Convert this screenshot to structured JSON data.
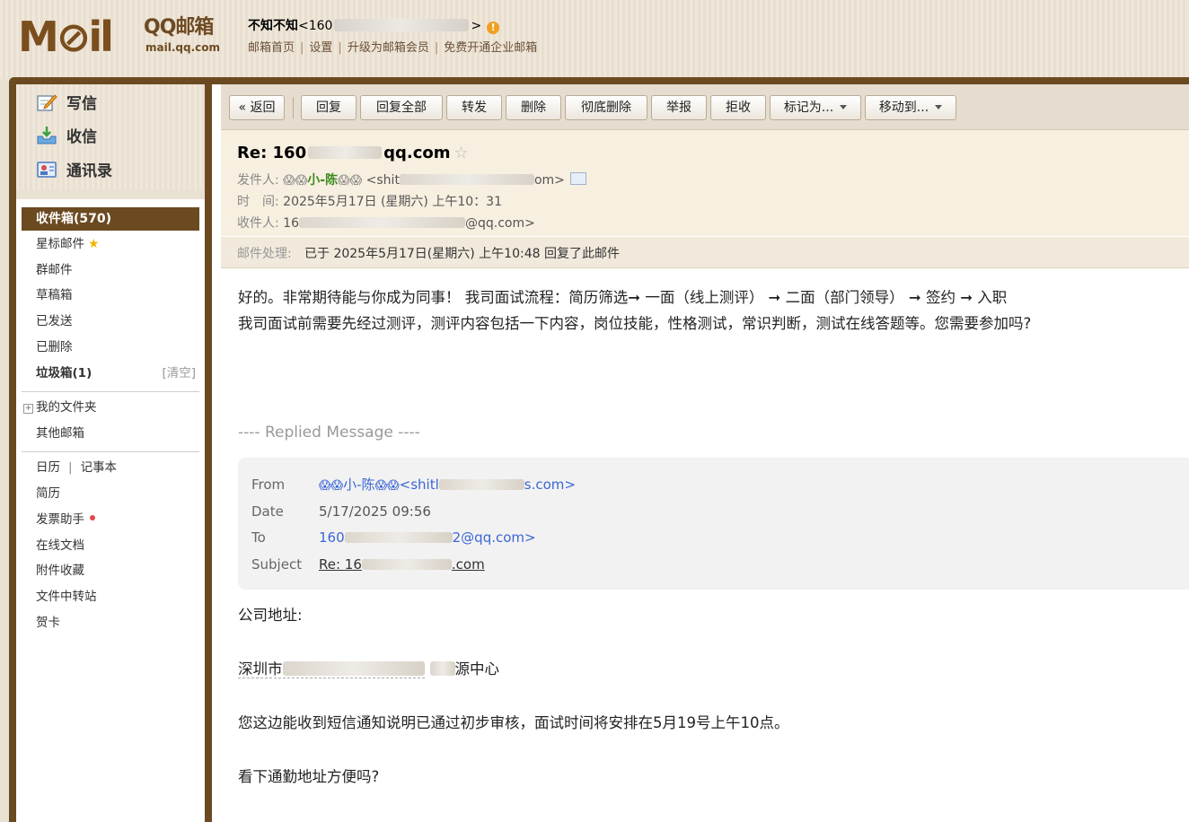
{
  "header": {
    "logo_mail": "M⊘il",
    "logo_qq": "QQ邮箱",
    "logo_sub": "mail.qq.com",
    "user_name": "不知不知",
    "user_email_prefix": "<160",
    "user_email_suffix": ">",
    "links": [
      "邮箱首页",
      "设置",
      "升级为邮箱会员",
      "免费开通企业邮箱"
    ]
  },
  "quick": {
    "compose": "写信",
    "receive": "收信",
    "contacts": "通讯录"
  },
  "nav": {
    "inbox": "收件箱(570)",
    "starred": "星标邮件",
    "group": "群邮件",
    "drafts": "草稿箱",
    "sent": "已发送",
    "deleted": "已删除",
    "spam": "垃圾箱(1)",
    "spam_clear": "[清空]",
    "my_folders": "我的文件夹",
    "other_mail": "其他邮箱",
    "calendar": "日历",
    "calendar_sep": "|",
    "notes": "记事本",
    "resume": "简历",
    "invoice": "发票助手",
    "docs": "在线文档",
    "attachments": "附件收藏",
    "transfer": "文件中转站",
    "cards": "贺卡"
  },
  "toolbar": {
    "back": "« 返回",
    "reply": "回复",
    "reply_all": "回复全部",
    "forward": "转发",
    "delete": "删除",
    "delete_perm": "彻底删除",
    "report": "举报",
    "reject": "拒收",
    "mark_as": "标记为...",
    "move_to": "移动到..."
  },
  "mail": {
    "subject_prefix": "Re: 160",
    "subject_suffix": "qq.com",
    "from_label": "发件人:",
    "from_name": "小-陈",
    "from_email_prefix": "<shit",
    "from_email_suffix": "om>",
    "time_label": "时　间:",
    "time_value": "2025年5月17日 (星期六) 上午10：31",
    "to_label": "收件人:",
    "to_prefix": "16",
    "to_suffix": "@qq.com>",
    "process_label": "邮件处理:",
    "process_text": "已于 2025年5月17日(星期六) 上午10:48 回复了此邮件",
    "body_line1": " 好的。非常期待能与你成为同事！ 我司面试流程：简历筛选➞ 一面（线上测评） ➞ 二面（部门领导） ➞ 签约 ➞ 入职",
    "body_line2": "我司面试前需要先经过测评，测评内容包括一下内容，岗位技能，性格测试，常识判断，测试在线答题等。您需要参加吗?",
    "replied_header": "---- Replied Message ----",
    "q_from_key": "From",
    "q_from_name": "小-陈",
    "q_from_email_prefix": "<shitl",
    "q_from_email_suffix": "s.com>",
    "q_date_key": "Date",
    "q_date_val": "5/17/2025 09:56",
    "q_to_key": "To",
    "q_to_prefix": "160",
    "q_to_suffix": "2@qq.com>",
    "q_subject_key": "Subject",
    "q_subject_prefix": "Re: 16",
    "q_subject_suffix": ".com",
    "company_addr_label": "公司地址:",
    "addr_prefix": "深圳市",
    "addr_suffix": "源中心",
    "notice": "您这边能收到短信通知说明已通过初步审核，面试时间将安排在5月19号上午10点。",
    "question": "看下通勤地址方便吗?"
  },
  "colors": {
    "frame": "#6b4a22",
    "active_nav": "#6b4a22",
    "sender_name": "#3c8a1e",
    "link_blue": "#3b66d6"
  },
  "icons": {
    "compose": "pencil-paper-icon",
    "receive": "inbox-download-icon",
    "contacts": "address-book-icon",
    "warn": "warning-icon",
    "star": "star-icon",
    "card": "contact-card-icon"
  }
}
